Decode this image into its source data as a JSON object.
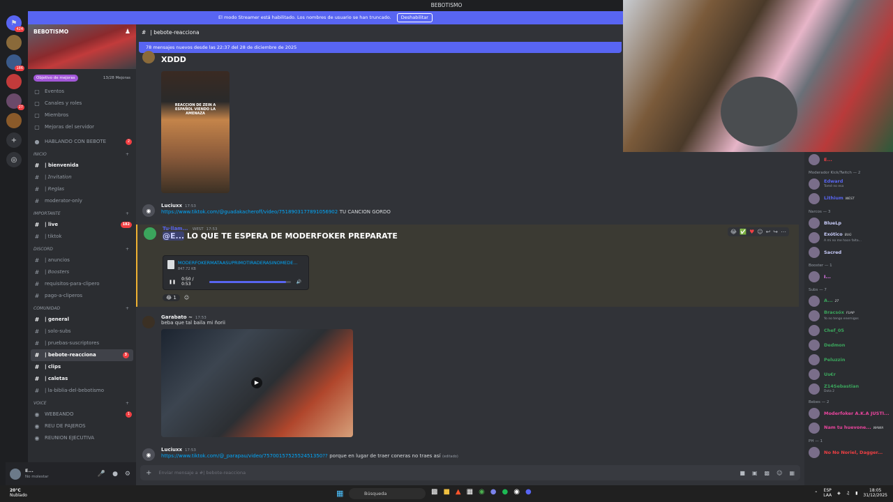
{
  "window_title": "BEBOTISMO",
  "streamer_banner": {
    "text": "El modo Streamer está habilitado. Los nombres de usuario se han truncado.",
    "button": "Deshabilitar"
  },
  "servers": [
    {
      "icon": "discord-icon",
      "badge": "424",
      "color": "#5865f2"
    },
    {
      "icon": "server-icon",
      "badge": "",
      "color": "#8a6a3a"
    },
    {
      "icon": "server-icon",
      "badge": "186",
      "color": "#3a5a8a"
    },
    {
      "icon": "server-icon",
      "badge": "",
      "color": "#c23b3b"
    },
    {
      "icon": "server-icon",
      "badge": "27",
      "color": "#6a4a6a"
    },
    {
      "icon": "server-icon",
      "badge": "",
      "color": "#8a5a2a"
    },
    {
      "icon": "add-server-icon",
      "badge": "",
      "color": "#313338"
    },
    {
      "icon": "explore-icon",
      "badge": "",
      "color": "#313338"
    }
  ],
  "sidebar": {
    "server_name": "BEBOTISMO",
    "boost_label": "Objetivo de mejoras",
    "boost_progress": "13/28 Mejoras",
    "top_items": [
      "Eventos",
      "Canales y roles",
      "Miembros",
      "Mejoras del servidor"
    ],
    "hablando": {
      "label": "HABLANDO CON BEBOTE",
      "badge": "2"
    },
    "categories": [
      {
        "name": "INICIO",
        "channels": [
          {
            "name": "| bienvenida",
            "unread": true,
            "badge": ""
          },
          {
            "name": "| 𝘐𝘯𝘷𝘪𝘵𝘢𝘵𝘪𝘰𝘯",
            "unread": false,
            "badge": ""
          },
          {
            "name": "| 𝘙𝘦𝘨𝘭𝘢𝘴",
            "unread": false,
            "badge": ""
          },
          {
            "name": "moderator-only",
            "unread": false,
            "badge": ""
          }
        ]
      },
      {
        "name": "IMPORTANTE",
        "channels": [
          {
            "name": "| live",
            "unread": true,
            "badge": "182"
          },
          {
            "name": "| tiktok",
            "unread": false,
            "badge": ""
          }
        ]
      },
      {
        "name": "DISCORD",
        "channels": [
          {
            "name": "| anuncios",
            "unread": false,
            "badge": ""
          },
          {
            "name": "| 𝘉𝘰𝘰𝘴𝘵𝘦𝘳𝘴",
            "unread": false,
            "badge": ""
          },
          {
            "name": "requisitos-para-clipero",
            "unread": false,
            "badge": ""
          },
          {
            "name": "pago-a-cliperos",
            "unread": false,
            "badge": ""
          }
        ]
      },
      {
        "name": "COMUNIDAD",
        "channels": [
          {
            "name": "| general",
            "unread": true,
            "badge": ""
          },
          {
            "name": "| solo-subs",
            "unread": false,
            "badge": ""
          },
          {
            "name": "| pruebas-suscriptores",
            "unread": false,
            "badge": ""
          },
          {
            "name": "| bebote-reacciona",
            "unread": true,
            "badge": "3",
            "active": true
          },
          {
            "name": "| clips",
            "unread": true,
            "badge": ""
          },
          {
            "name": "| caletas",
            "unread": true,
            "badge": ""
          },
          {
            "name": "| la-biblia-del-bebotismo",
            "unread": false,
            "badge": ""
          }
        ]
      },
      {
        "name": "VOICE",
        "channels": [
          {
            "name": "WEBEANDO",
            "unread": false,
            "badge": "1"
          },
          {
            "name": "REU DE PAJEROS",
            "unread": false,
            "badge": ""
          },
          {
            "name": "REUNION EJECUTIVA",
            "unread": false,
            "badge": ""
          }
        ]
      }
    ]
  },
  "user_panel": {
    "name": "E...",
    "status": "No molestar"
  },
  "channel": {
    "name": "| bebote-reacciona",
    "new_messages": "78 mensajes nuevos desde las 22:37 del 28 de diciembre de 2025"
  },
  "messages": {
    "m0": {
      "text": "XDDD",
      "thumb_caption": "REACCION DE ZEIN A ESPAÑOL VIENDO LA AMENAZA"
    },
    "m1": {
      "author": "Luciuxx",
      "time": "17:53",
      "link": "https://www.tiktok.com/@guadakacheroff/video/7518903177891056902",
      "text": "TU CANCION GORDO"
    },
    "m2": {
      "author": "Tu·llam...",
      "time": "17:53",
      "tag": "WEST",
      "mention": "@E...",
      "text": "LO QUE TE ESPERA DE MODERFOKER PREPARATE",
      "file": "MODERFOKERMATAASUPRIMOTIRADERASINOMEDE...",
      "size": "847.72 KB",
      "audio_time": "0:50 / 0:53",
      "audio_progress": 0.94,
      "reaction_count": "1"
    },
    "m3": {
      "author": "Garabato ~",
      "time": "17:53",
      "text": "beba que tal baila mi ñorii"
    },
    "m4": {
      "author": "Luciuxx",
      "time": "17:53",
      "link": "https://www.tiktok.com/@_parapau/video/7570015752552451350??",
      "text": "porque en lugar de traer coneras no traes así",
      "edited": "(editado)"
    }
  },
  "input": {
    "placeholder": "Enviar mensaje a #| bebote-reacciona"
  },
  "members": [
    {
      "type": "row",
      "name": "E...",
      "sub": "",
      "color": "#f23f43"
    },
    {
      "type": "cat",
      "name": "Moderador Kick/Twitch — 2"
    },
    {
      "type": "row",
      "name": "Edward",
      "sub": "Tomé no esa",
      "color": "#5865f2"
    },
    {
      "type": "row",
      "name": "Lithium",
      "sub": "",
      "color": "#5865f2",
      "tag": "WEST"
    },
    {
      "type": "cat",
      "name": "Narcos — 3"
    },
    {
      "type": "row",
      "name": "BlueLp",
      "sub": "",
      "color": "#c9cdfb"
    },
    {
      "type": "row",
      "name": "Exótico",
      "sub": "A mi no me hace falta...",
      "color": "#c9cdfb",
      "tag": "BUG"
    },
    {
      "type": "row",
      "name": "Sacred",
      "sub": "",
      "color": "#c9cdfb"
    },
    {
      "type": "cat",
      "name": "Booster — 1"
    },
    {
      "type": "row",
      "name": "I...",
      "sub": "",
      "color": "#f47fff"
    },
    {
      "type": "cat",
      "name": "Subs — 7"
    },
    {
      "type": "row",
      "name": "A...",
      "sub": "",
      "color": "#3ba55c",
      "tag": "27"
    },
    {
      "type": "row",
      "name": "Bracsóx",
      "sub": "Yo no tengo enemigos",
      "color": "#3ba55c",
      "tag": "FUAP"
    },
    {
      "type": "row",
      "name": "Chef_05",
      "sub": "",
      "color": "#3ba55c"
    },
    {
      "type": "row",
      "name": "Dedmon",
      "sub": "",
      "color": "#3ba55c"
    },
    {
      "type": "row",
      "name": "Peluzzin",
      "sub": "",
      "color": "#3ba55c"
    },
    {
      "type": "row",
      "name": "Us€r",
      "sub": "",
      "color": "#3ba55c"
    },
    {
      "type": "row",
      "name": "Z14Sebastian",
      "sub": "Dota 2",
      "color": "#3ba55c"
    },
    {
      "type": "cat",
      "name": "Bebes — 2"
    },
    {
      "type": "row",
      "name": "Moderfoker A.K.A JUSTI...",
      "sub": "",
      "color": "#eb459e"
    },
    {
      "type": "row",
      "name": "Nam tu huevone...",
      "sub": "",
      "color": "#eb459e",
      "tag": "WAWA"
    },
    {
      "type": "cat",
      "name": "PH — 1"
    },
    {
      "type": "row",
      "name": "No No Noriel, Dagger...",
      "sub": "",
      "color": "#f23f43"
    }
  ],
  "taskbar": {
    "temp": "20°C",
    "weather": "Nublado",
    "search": "Búsqueda",
    "lang": "ESP",
    "lang2": "LAA",
    "time": "18:05",
    "date": "31/12/2025"
  }
}
